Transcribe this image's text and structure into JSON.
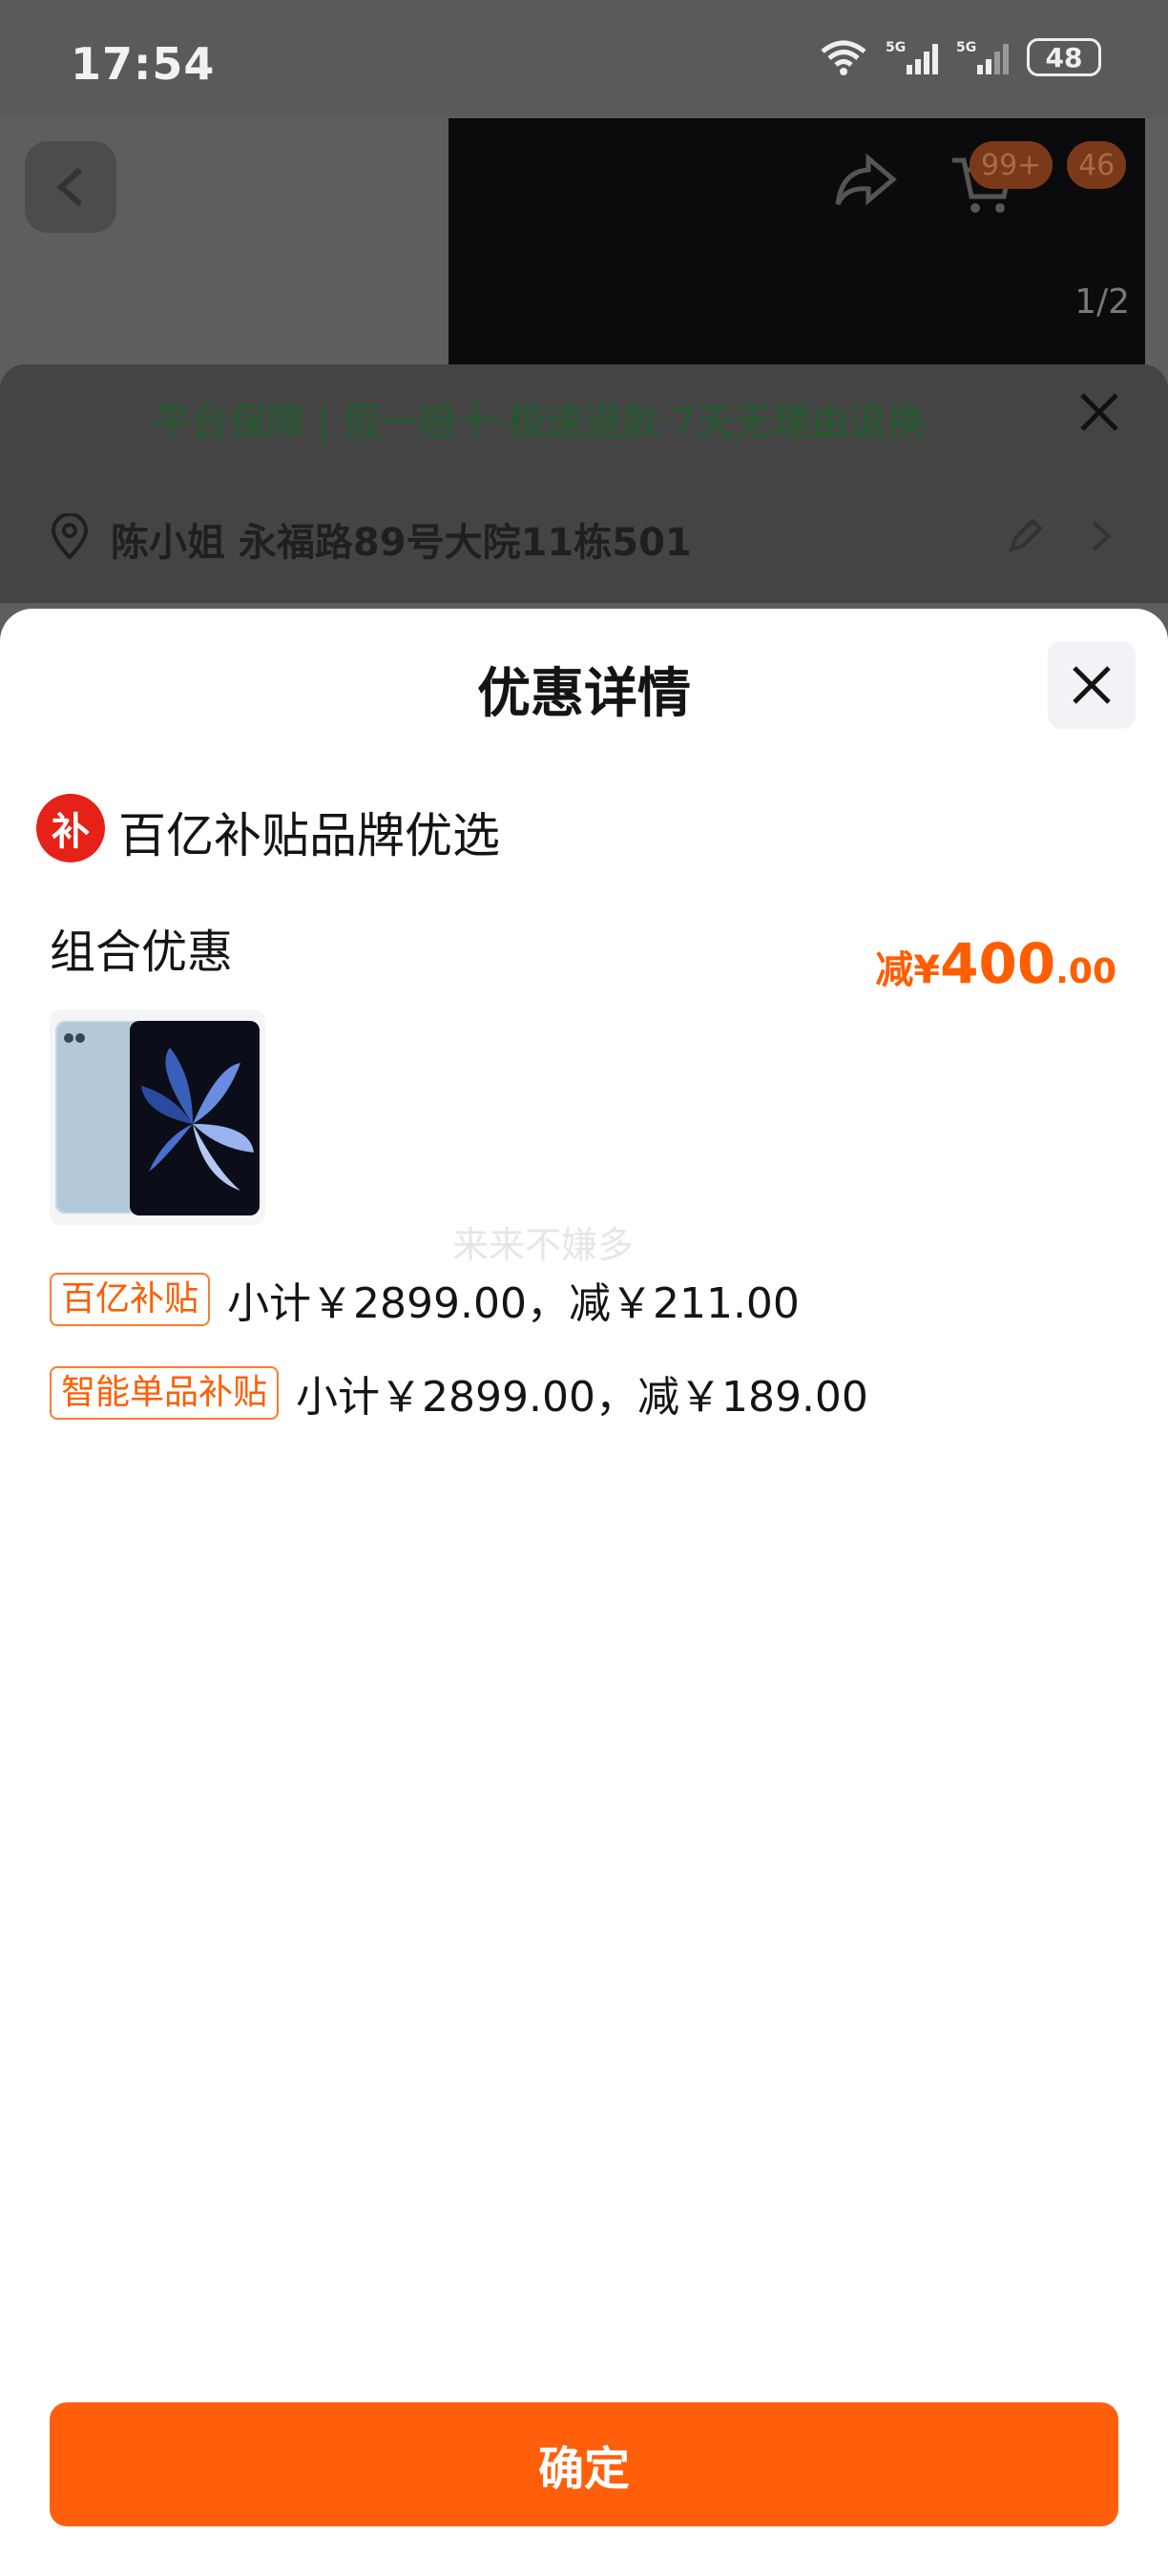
{
  "status_bar": {
    "time": "17:54",
    "battery": "48"
  },
  "background_page": {
    "image_counter": "1/2",
    "cart_badge": "99+",
    "msg_badge": "46",
    "guarantee": "平台保障 | 假一赔十·极速退款·7天无理由退换",
    "address": "陈小姐 永福路89号大院11栋501"
  },
  "modal": {
    "title": "优惠详情",
    "brand": {
      "logo_char": "补",
      "name": "百亿补贴品牌优选"
    },
    "combo": {
      "label": "组合优惠",
      "amount_prefix": "减¥",
      "amount_int": "400",
      "amount_dec": ".00"
    },
    "watermark": "来来不嫌多",
    "subsidies": [
      {
        "tag": "百亿补贴",
        "text": "小计￥2899.00，减￥211.00"
      },
      {
        "tag": "智能单品补贴",
        "text": "小计￥2899.00，减￥189.00"
      }
    ],
    "confirm_label": "确定"
  },
  "colors": {
    "accent": "#ff5f0a",
    "brand_red": "#e62117"
  }
}
